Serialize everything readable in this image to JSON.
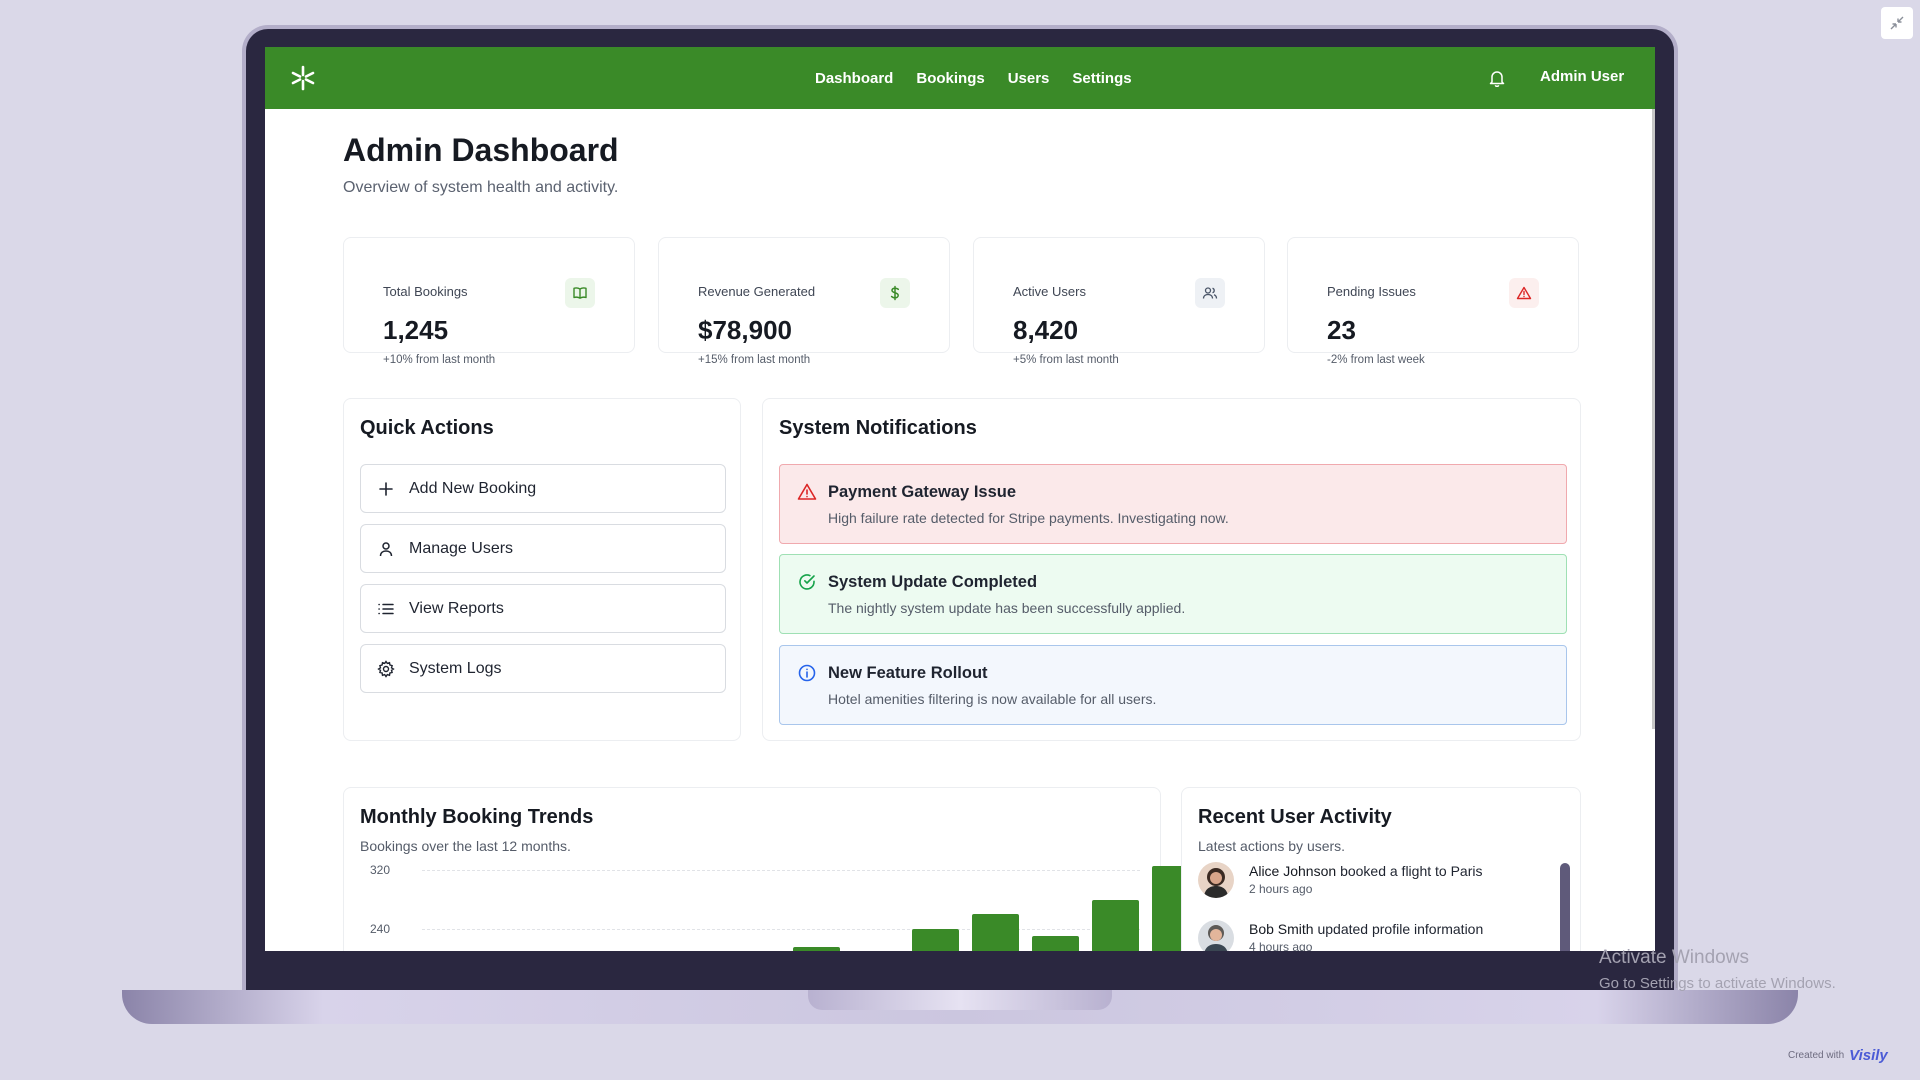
{
  "nav": {
    "items": [
      "Dashboard",
      "Bookings",
      "Users",
      "Settings"
    ],
    "user": "Admin User"
  },
  "page": {
    "title": "Admin Dashboard",
    "subtitle": "Overview of system health and activity."
  },
  "stats": [
    {
      "label": "Total Bookings",
      "value": "1,245",
      "change": "+10% from last month",
      "icon": "book-icon",
      "color": "#3a8a28"
    },
    {
      "label": "Revenue Generated",
      "value": "$78,900",
      "change": "+15% from last month",
      "icon": "dollar-icon",
      "color": "#3a8a28"
    },
    {
      "label": "Active Users",
      "value": "8,420",
      "change": "+5% from last month",
      "icon": "users-icon",
      "color": "#4a5568"
    },
    {
      "label": "Pending Issues",
      "value": "23",
      "change": "-2% from last week",
      "icon": "alert-icon",
      "color": "#dc2626"
    }
  ],
  "quick_actions": {
    "title": "Quick Actions",
    "buttons": [
      {
        "label": "Add New Booking",
        "icon": "plus-icon"
      },
      {
        "label": "Manage Users",
        "icon": "user-icon"
      },
      {
        "label": "View Reports",
        "icon": "list-icon"
      },
      {
        "label": "System Logs",
        "icon": "gear-icon"
      }
    ]
  },
  "notifications": {
    "title": "System Notifications",
    "items": [
      {
        "title": "Payment Gateway Issue",
        "text": "High failure rate detected for Stripe payments. Investigating now.",
        "kind": "error",
        "icon": "alert-triangle-icon"
      },
      {
        "title": "System Update Completed",
        "text": "The nightly system update has been successfully applied.",
        "kind": "success",
        "icon": "check-circle-icon"
      },
      {
        "title": "New Feature Rollout",
        "text": "Hotel amenities filtering is now available for all users.",
        "kind": "info",
        "icon": "info-icon"
      }
    ]
  },
  "trends": {
    "title": "Monthly Booking Trends",
    "subtitle": "Bookings over the last 12 months."
  },
  "chart_data": {
    "type": "bar",
    "title": "Monthly Booking Trends",
    "yticks": [
      320,
      240
    ],
    "values": [
      null,
      null,
      null,
      null,
      null,
      null,
      215,
      null,
      240,
      260,
      230,
      280,
      325
    ],
    "color": "#3a8a28"
  },
  "activity": {
    "title": "Recent User Activity",
    "subtitle": "Latest actions by users.",
    "items": [
      {
        "name": "Alice Johnson",
        "action": "booked a flight to Paris",
        "time": "2 hours ago"
      },
      {
        "name": "Bob Smith",
        "action": "updated profile information",
        "time": "4 hours ago"
      }
    ]
  },
  "watermark": {
    "line1": "Activate Windows",
    "line2": "Go to Settings to activate Windows."
  },
  "credit": {
    "prefix": "Created with",
    "brand": "Visily"
  }
}
